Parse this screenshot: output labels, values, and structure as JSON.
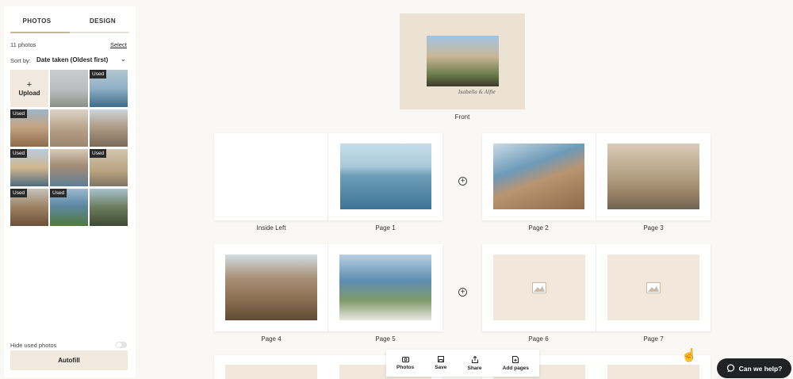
{
  "sidebar": {
    "tabs": [
      "PHOTOS",
      "DESIGN"
    ],
    "photo_count": "11 photos",
    "select_label": "Select",
    "sort_label": "Sort by:",
    "sort_value": "Date taken (Oldest first)",
    "upload_label": "Upload",
    "used_badge": "Used",
    "hide_used_label": "Hide used photos",
    "autofill_label": "Autofill"
  },
  "book": {
    "front_label": "Front",
    "cover_text": "Isabella & Alfie",
    "pages": [
      "Inside Left",
      "Page 1",
      "Page 2",
      "Page 3",
      "Page 4",
      "Page 5",
      "Page 6",
      "Page 7"
    ]
  },
  "toolbar": {
    "photos": "Photos",
    "save": "Save",
    "share": "Share",
    "add_pages": "Add pages"
  },
  "help": {
    "label": "Can we help?"
  }
}
